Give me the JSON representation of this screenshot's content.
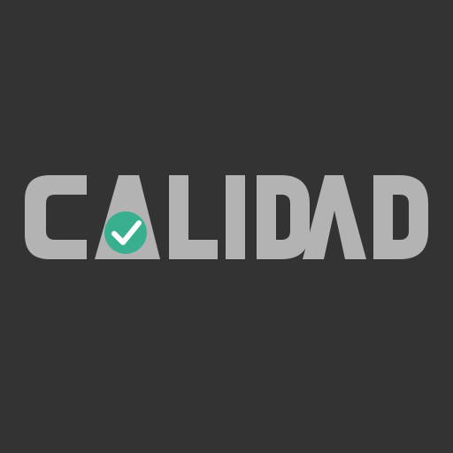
{
  "logo": {
    "wordmark": "CALIDAD",
    "letter_color": "#b3b3b3",
    "background_color": "#333333",
    "badge_color": "#3aaf8f",
    "check_color": "#ffffff",
    "badge_icon": "check-circle-icon"
  }
}
